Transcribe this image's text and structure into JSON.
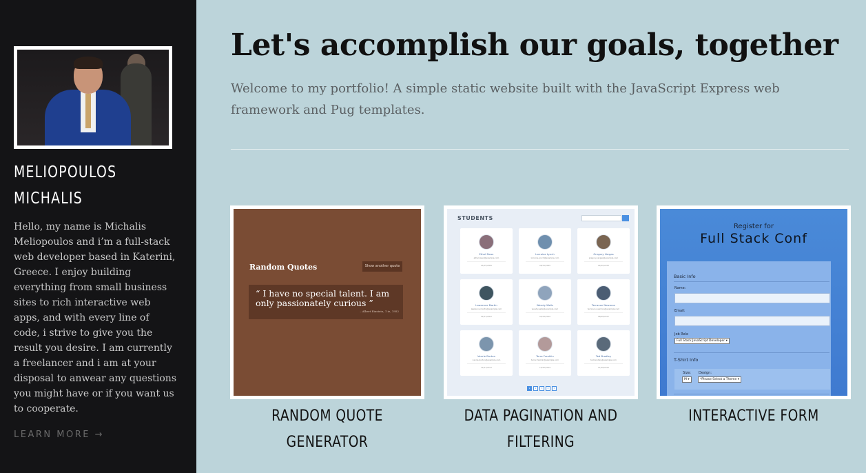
{
  "sidebar": {
    "name_line1": "MELIOPOULOS",
    "name_line2": "MICHALIS",
    "bio": "Hello, my name is Michalis Meliopoulos and i’m a full-stack web developer based in Katerini, Greece. I enjoy building everything from small business sites to rich interactive web apps, and with every line of code, i strive to give you the result you desire. I am currently a freelancer and i am at your disposal to anwear any questions you might have or if you want us to cooperate.",
    "learn_more": "LEARN MORE →"
  },
  "main": {
    "headline": "Let's accomplish our goals, together",
    "intro": "Welcome to my portfolio! A simple static website built with the JavaScript Express web framework and Pug templates."
  },
  "projects": [
    {
      "caption": "RANDOM QUOTE GENERATOR",
      "preview": {
        "title": "Random Quotes",
        "button": "Show another quote",
        "quote": "I have no special talent. I am only passionately curious",
        "cite": "– Albert Einstein, 1 ie, 1952"
      }
    },
    {
      "caption": "DATA PAGINATION AND FILTERING",
      "preview": {
        "title": "STUDENTS",
        "search_placeholder": "Search by name...",
        "students": [
          {
            "name": "Ethel Dean",
            "email": "ethel.dean@example.com",
            "date": "05/15/2005"
          },
          {
            "name": "Lorraine Lynch",
            "email": "lorraine.lynch@example.com",
            "date": "08/31/2005"
          },
          {
            "name": "Gregory Vargas",
            "email": "gregory.vargas@example.com",
            "date": "04/20/2012"
          },
          {
            "name": "Lawrence Martin",
            "email": "lawrence.martin@example.com",
            "date": "02/11/2007"
          },
          {
            "name": "Wendy Wells",
            "email": "wendy.wells@example.com",
            "date": "05/23/2010"
          },
          {
            "name": "Terrance Newman",
            "email": "terrance.newman@example.com",
            "date": "08/28/2017"
          },
          {
            "name": "Vanrie Burton",
            "email": "vanrie.burton@example.com",
            "date": "12/11/2017"
          },
          {
            "name": "Terra Franklin",
            "email": "terra.franklin@example.com",
            "date": "10/25/2019"
          },
          {
            "name": "Ted Bradley",
            "email": "ted.bradley@example.com",
            "date": "11/28/2012"
          }
        ],
        "pages": [
          "1",
          "2",
          "3",
          "4",
          "5"
        ]
      }
    },
    {
      "caption": "INTERACTIVE FORM",
      "preview": {
        "subtitle": "Register for",
        "title": "Full Stack Conf",
        "basic_info": "Basic Info",
        "name_label": "Name:",
        "email_label": "Email:",
        "job_label": "Job Role",
        "job_value": "Full Stack JavaScript Developer",
        "tshirt_info": "T-Shirt Info",
        "size_label": "Size:",
        "size_value": "M",
        "design_label": "Design:",
        "design_value": "Please Select a Theme"
      }
    }
  ],
  "colors": {
    "sidebar_bg": "#141416",
    "page_bg": "#bcd4da",
    "quote_bg": "#7a4c34",
    "form_bg": "#4a8ad8"
  }
}
